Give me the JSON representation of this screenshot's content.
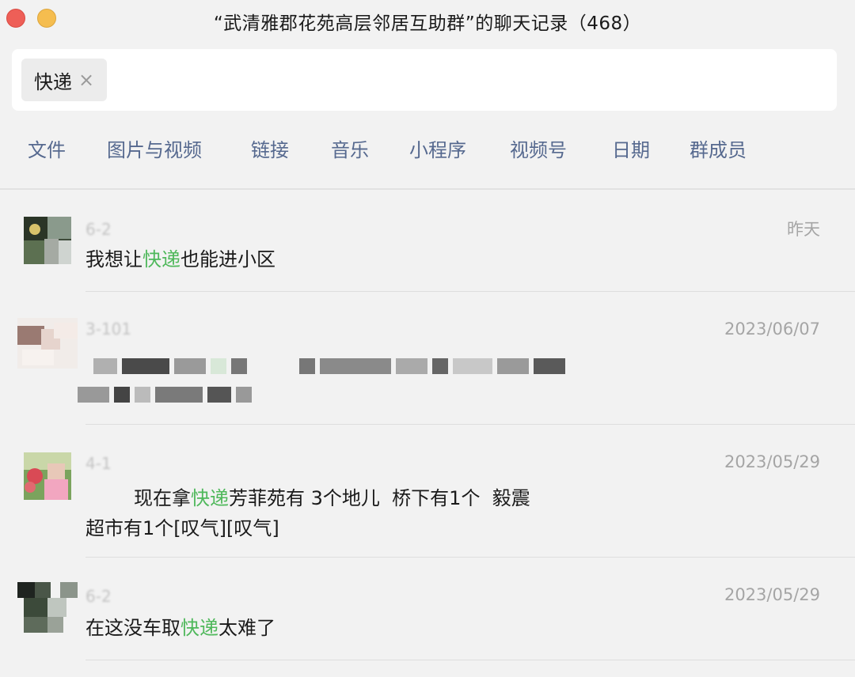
{
  "window": {
    "title": "“武清雅郡花苑高层邻居互助群”的聊天记录（468）"
  },
  "search": {
    "tag": "快递",
    "clear_icon": "×"
  },
  "filters": [
    "文件",
    "图片与视频",
    "链接",
    "音乐",
    "小程序",
    "视频号",
    "日期",
    "群成员"
  ],
  "messages": [
    {
      "sender": "6-2",
      "time": "昨天",
      "lines": [
        [
          "我想让",
          "快递",
          "也能进小区"
        ]
      ]
    },
    {
      "sender": "3-101",
      "time": "2023/06/07",
      "lines": []
    },
    {
      "sender": "4-1",
      "time": "2023/05/29",
      "lines": [
        [
          "        现在拿",
          "快递",
          "芳菲苑有 3个地儿  桥下有1个  毅震"
        ],
        [
          "超市有1个[叹气][叹气]",
          "",
          ""
        ]
      ]
    },
    {
      "sender": "6-2",
      "time": "2023/05/29",
      "lines": [
        [
          "在这没车取",
          "快递",
          "太难了"
        ]
      ]
    }
  ],
  "colors": {
    "highlight": "#4fb85b",
    "filter_text": "#56698f",
    "background": "#f2f2f2"
  }
}
